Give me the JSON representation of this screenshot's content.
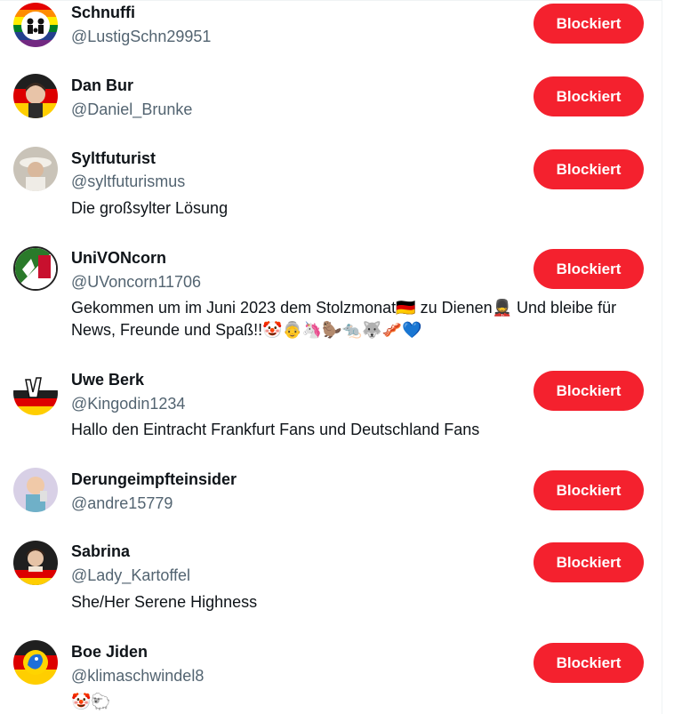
{
  "block_label": "Blockiert",
  "accounts": [
    {
      "name": "Schnuffi",
      "handle": "@LustigSchn29951",
      "bio": ""
    },
    {
      "name": "Dan Bur",
      "handle": "@Daniel_Brunke",
      "bio": ""
    },
    {
      "name": "Syltfuturist",
      "handle": "@syltfuturismus",
      "bio": "Die großsylter Lösung"
    },
    {
      "name": "UniVONcorn",
      "handle": "@UVoncorn11706",
      "bio": "Gekommen um im Juni 2023 dem Stolzmonat🇩🇪 zu Dienen💂 Und bleibe für News, Freunde und Spaß!!🤡👵🦄🦫🐀🐺🥓💙"
    },
    {
      "name": "Uwe Berk",
      "handle": "@Kingodin1234",
      "bio": "Hallo den Eintracht Frankfurt Fans und Deutschland Fans"
    },
    {
      "name": "Derungeimpfteinsider",
      "handle": "@andre15779",
      "bio": ""
    },
    {
      "name": "Sabrina",
      "handle": "@Lady_Kartoffel",
      "bio": "She/Her Serene Highness"
    },
    {
      "name": "Boe Jiden",
      "handle": "@klimaschwindel8",
      "bio": "🤡🐑"
    }
  ],
  "colors": {
    "block_button": "#f4212e",
    "handle_text": "#536471",
    "primary_text": "#0f1419"
  }
}
